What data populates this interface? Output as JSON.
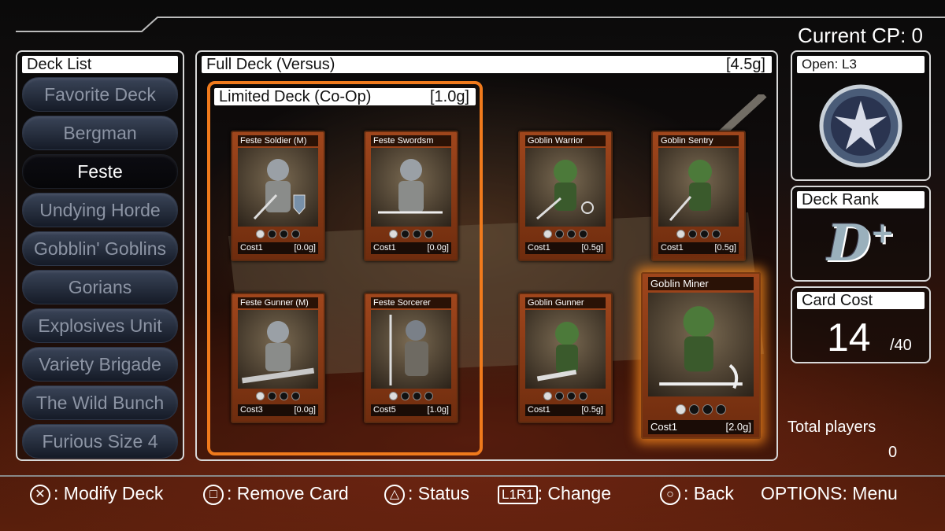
{
  "current_cp": "Current CP: 0",
  "deck_list": {
    "title": "Deck List",
    "items": [
      "Favorite Deck",
      "Bergman",
      "Feste",
      "Undying Horde",
      "Gobblin' Goblins",
      "Gorians",
      "Explosives Unit",
      "Variety Brigade",
      "The Wild Bunch",
      "Furious Size 4"
    ],
    "selected": "Feste"
  },
  "full_deck": {
    "title": "Full Deck (Versus)",
    "cost": "[4.5g]"
  },
  "limited_deck": {
    "title": "Limited Deck (Co-Op)",
    "cost": "[1.0g]"
  },
  "cards": [
    {
      "name": "Feste Soldier (M)",
      "cost": "Cost1",
      "gold": "[0.0g]",
      "dots_on": 1
    },
    {
      "name": "Feste Swordsm",
      "cost": "Cost1",
      "gold": "[0.0g]",
      "dots_on": 1
    },
    {
      "name": "Goblin Warrior",
      "cost": "Cost1",
      "gold": "[0.5g]",
      "dots_on": 1
    },
    {
      "name": "Goblin Sentry",
      "cost": "Cost1",
      "gold": "[0.5g]",
      "dots_on": 1
    },
    {
      "name": "Feste Gunner (M)",
      "cost": "Cost3",
      "gold": "[0.0g]",
      "dots_on": 1
    },
    {
      "name": "Feste Sorcerer",
      "cost": "Cost5",
      "gold": "[1.0g]",
      "dots_on": 1
    },
    {
      "name": "Goblin Gunner",
      "cost": "Cost1",
      "gold": "[0.5g]",
      "dots_on": 1
    },
    {
      "name": "Goblin Miner",
      "cost": "Cost1",
      "gold": "[2.0g]",
      "dots_on": 1
    }
  ],
  "open_panel": {
    "title": "Open: L3",
    "icon": "winged-crest-emblem"
  },
  "deck_rank": {
    "title": "Deck Rank",
    "value": "D",
    "modifier": "+"
  },
  "card_cost": {
    "title": "Card Cost",
    "value": "14",
    "max": "/40"
  },
  "total_players": {
    "label": "Total players",
    "value": "0"
  },
  "controls": [
    {
      "button": "✕",
      "label": ": Modify Deck"
    },
    {
      "button": "□",
      "label": ": Remove Card"
    },
    {
      "button": "△",
      "label": ": Status"
    },
    {
      "button": "L1R1",
      "label": ": Change"
    },
    {
      "button": "○",
      "label": ": Back"
    },
    {
      "button": "OPTIONS",
      "label": ": Menu"
    }
  ],
  "colors": {
    "highlight": "#f07a1c",
    "card_frame": "#a0461c",
    "panel_border": "#d8d8d8"
  }
}
